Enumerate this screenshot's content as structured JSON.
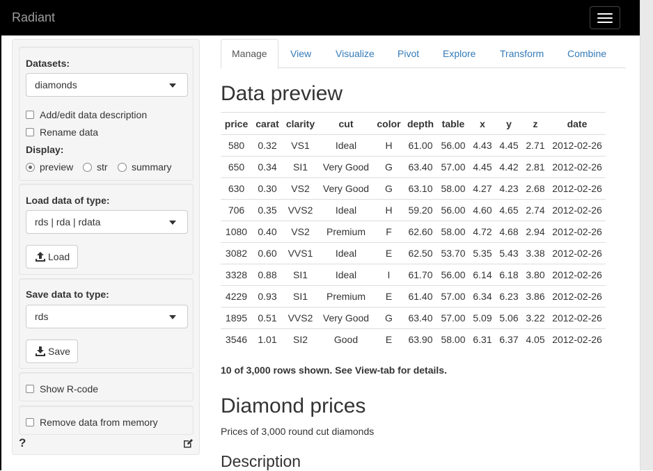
{
  "navbar": {
    "brand": "Radiant"
  },
  "sidebar": {
    "datasets_label": "Datasets:",
    "dataset_value": "diamonds",
    "add_edit_label": "Add/edit data description",
    "rename_label": "Rename data",
    "display_label": "Display:",
    "display_options": [
      "preview",
      "str",
      "summary"
    ],
    "load_label": "Load data of type:",
    "load_type_value": "rds | rda | rdata",
    "load_button": "Load",
    "save_label": "Save data to type:",
    "save_type_value": "rds",
    "save_button": "Save",
    "show_rcode_label": "Show R-code",
    "remove_label": "Remove data from memory",
    "help": "?"
  },
  "tabs": [
    "Manage",
    "View",
    "Visualize",
    "Pivot",
    "Explore",
    "Transform",
    "Combine"
  ],
  "main": {
    "preview_title": "Data preview",
    "rows_note": "10 of 3,000 rows shown. See View-tab for details.",
    "dataset_title": "Diamond prices",
    "dataset_subtitle": "Prices of 3,000 round cut diamonds",
    "description_title": "Description"
  },
  "table": {
    "columns": [
      "price",
      "carat",
      "clarity",
      "cut",
      "color",
      "depth",
      "table",
      "x",
      "y",
      "z",
      "date"
    ],
    "rows": [
      [
        "580",
        "0.32",
        "VS1",
        "Ideal",
        "H",
        "61.00",
        "56.00",
        "4.43",
        "4.45",
        "2.71",
        "2012-02-26"
      ],
      [
        "650",
        "0.34",
        "SI1",
        "Very Good",
        "G",
        "63.40",
        "57.00",
        "4.45",
        "4.42",
        "2.81",
        "2012-02-26"
      ],
      [
        "630",
        "0.30",
        "VS2",
        "Very Good",
        "G",
        "63.10",
        "58.00",
        "4.27",
        "4.23",
        "2.68",
        "2012-02-26"
      ],
      [
        "706",
        "0.35",
        "VVS2",
        "Ideal",
        "H",
        "59.20",
        "56.00",
        "4.60",
        "4.65",
        "2.74",
        "2012-02-26"
      ],
      [
        "1080",
        "0.40",
        "VS2",
        "Premium",
        "F",
        "62.60",
        "58.00",
        "4.72",
        "4.68",
        "2.94",
        "2012-02-26"
      ],
      [
        "3082",
        "0.60",
        "VVS1",
        "Ideal",
        "E",
        "62.50",
        "53.70",
        "5.35",
        "5.43",
        "3.38",
        "2012-02-26"
      ],
      [
        "3328",
        "0.88",
        "SI1",
        "Ideal",
        "I",
        "61.70",
        "56.00",
        "6.14",
        "6.18",
        "3.80",
        "2012-02-26"
      ],
      [
        "4229",
        "0.93",
        "SI1",
        "Premium",
        "E",
        "61.40",
        "57.00",
        "6.34",
        "6.23",
        "3.86",
        "2012-02-26"
      ],
      [
        "1895",
        "0.51",
        "VVS2",
        "Very Good",
        "G",
        "63.40",
        "57.00",
        "5.09",
        "5.06",
        "3.22",
        "2012-02-26"
      ],
      [
        "3546",
        "1.01",
        "SI2",
        "Good",
        "E",
        "63.90",
        "58.00",
        "6.31",
        "6.37",
        "4.05",
        "2012-02-26"
      ]
    ]
  },
  "colors": {
    "navbar": "#000000",
    "link": "#337ab7",
    "well_bg": "#f5f5f5"
  }
}
